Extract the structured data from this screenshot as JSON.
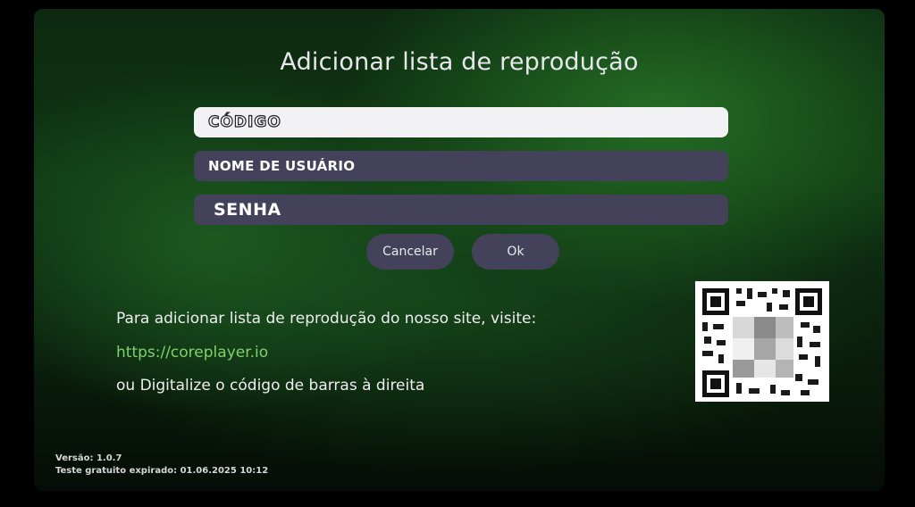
{
  "dialog": {
    "title": "Adicionar lista de reprodução",
    "fields": {
      "code_label": "CÓDIGO",
      "username_label": "NOME DE USUÁRIO",
      "password_label": "SENHA"
    },
    "buttons": {
      "cancel": "Cancelar",
      "ok": "Ok"
    }
  },
  "info": {
    "line1": "Para adicionar lista de reprodução do nosso site, visite:",
    "url": "https://coreplayer.io",
    "line3": "ou Digitalize o código de barras à direita"
  },
  "qr_icon": "qr-code",
  "footer": {
    "version": "Versão: 1.0.7",
    "trial": "Teste gratuito expirado: 01.06.2025 10:12"
  },
  "colors": {
    "field_bg": "#44425a",
    "field_active_bg": "#f2f2f4",
    "link": "#7ed36c"
  }
}
